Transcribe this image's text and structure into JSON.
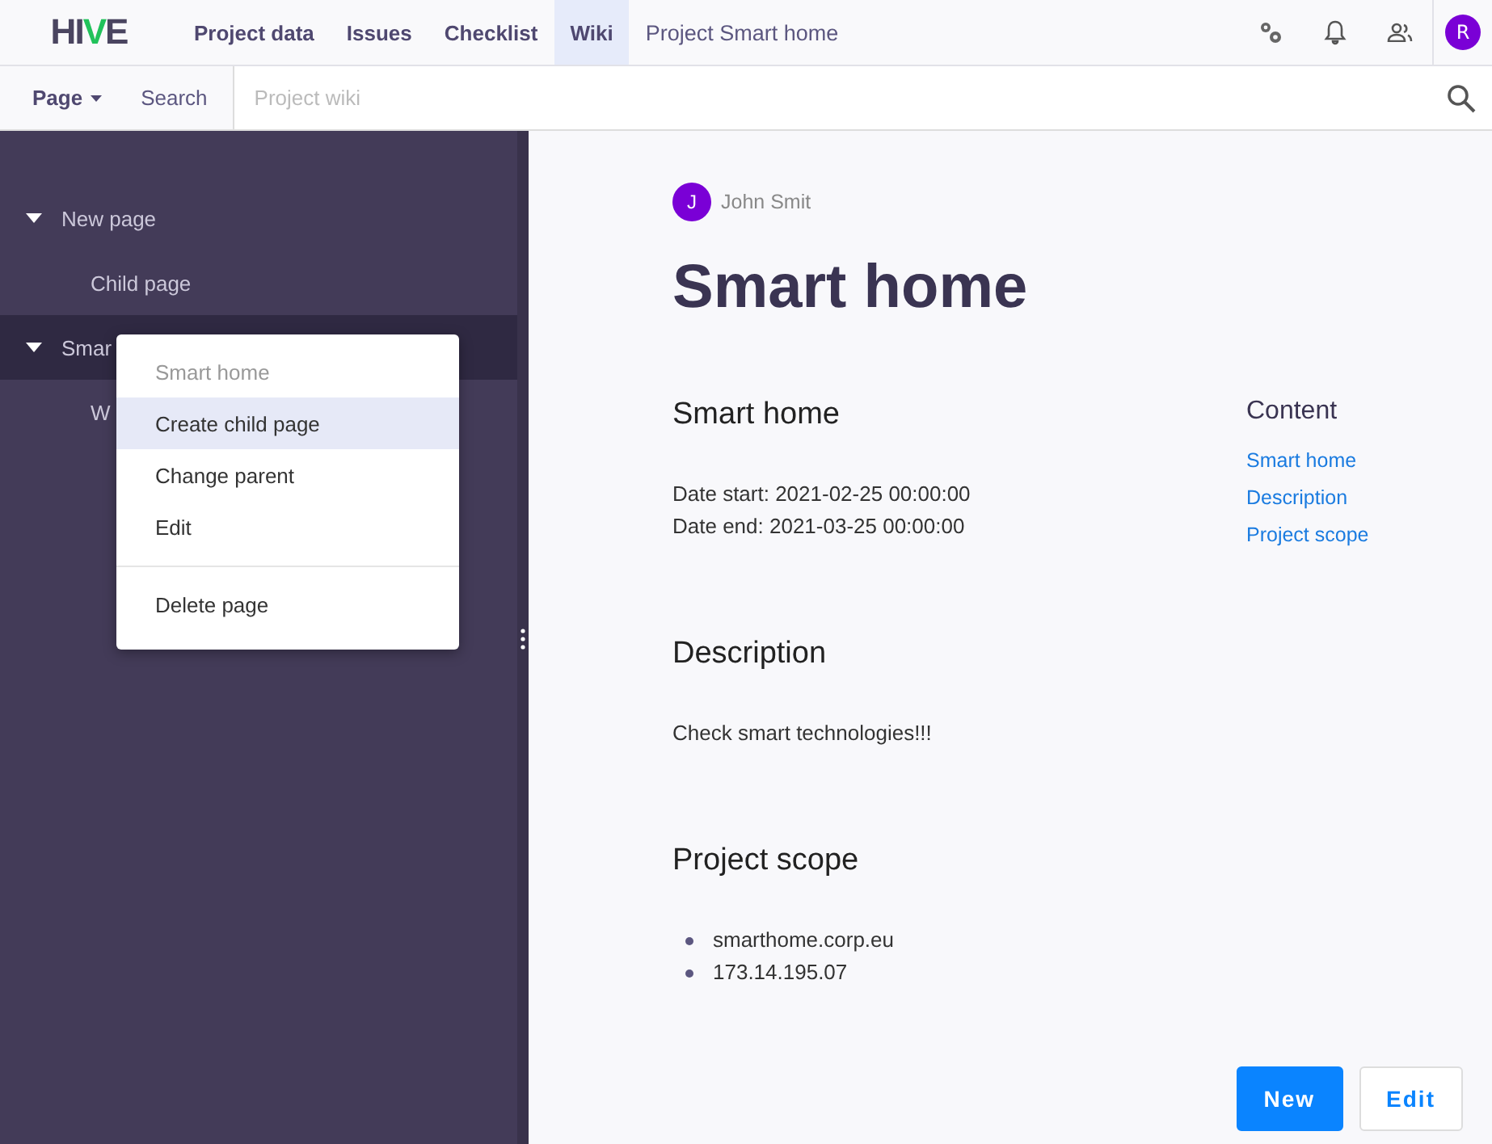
{
  "logo": {
    "text": "HIVE"
  },
  "nav": [
    {
      "label": "Project data",
      "selected": false
    },
    {
      "label": "Issues",
      "selected": false
    },
    {
      "label": "Checklist",
      "selected": false
    },
    {
      "label": "Wiki",
      "selected": true
    }
  ],
  "project": "Project Smart home",
  "user_avatar": "R",
  "toolbar": {
    "page_menu": "Page",
    "search_label": "Search",
    "search": {
      "placeholder": "Project wiki"
    }
  },
  "tree": [
    {
      "label": "New page",
      "expanded": true,
      "selected": false,
      "children": [
        {
          "label": "Child page",
          "selected": false
        }
      ]
    },
    {
      "label": "Smar",
      "expanded": true,
      "selected": true,
      "children": [
        {
          "label": "W",
          "selected": false
        }
      ]
    }
  ],
  "context_menu": [
    {
      "kind": "title",
      "label": "Smart home",
      "selected": false,
      "divider_before": false
    },
    {
      "kind": "action",
      "label": "Create child page",
      "selected": true,
      "divider_before": false
    },
    {
      "kind": "action",
      "label": "Change parent",
      "selected": false,
      "divider_before": false
    },
    {
      "kind": "action",
      "label": "Edit",
      "selected": false,
      "divider_before": false
    },
    {
      "kind": "action",
      "label": "Delete page",
      "selected": false,
      "divider_before": true
    }
  ],
  "article": {
    "author_initial": "J",
    "author": "John Smit",
    "title": "Smart home",
    "sections": [
      {
        "heading": "Smart home",
        "lines": [
          "Date start: 2021-02-25 00:00:00",
          "Date end: 2021-03-25 00:00:00"
        ]
      },
      {
        "heading": "Description",
        "lines": [
          "Check smart technologies!!!"
        ]
      },
      {
        "heading": "Project scope",
        "bullets": [
          "smarthome.corp.eu",
          "173.14.195.07"
        ]
      }
    ],
    "toc_title": "Content",
    "toc": [
      "Smart home",
      "Description",
      "Project scope"
    ]
  },
  "buttons": [
    {
      "label": "New",
      "kind": "primary"
    },
    {
      "label": "Edit",
      "kind": "secondary"
    }
  ]
}
